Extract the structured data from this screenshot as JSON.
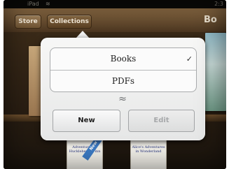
{
  "status_bar": {
    "carrier": "iPad",
    "wifi_icon": "wifi-icon",
    "clock": "2:3"
  },
  "toolbar": {
    "store_label": "Store",
    "collections_label": "Collections",
    "title_partial": "Bo"
  },
  "popover": {
    "items": [
      {
        "label": "Books",
        "checked": true,
        "check_glyph": "✓"
      },
      {
        "label": "PDFs",
        "checked": false
      }
    ],
    "new_label": "New",
    "edit_label": "Edit",
    "edit_enabled": false
  },
  "shelf": {
    "books": [
      {
        "title": "Adventures of Huckleberry Finn",
        "ribbon": "New"
      },
      {
        "title": "Alice's Adventures in Wonderland"
      }
    ]
  },
  "colors": {
    "toolbar_wood": "#6d5233",
    "popover_bg": "#f2f2f1",
    "ribbon_blue": "#3d7cc6"
  }
}
